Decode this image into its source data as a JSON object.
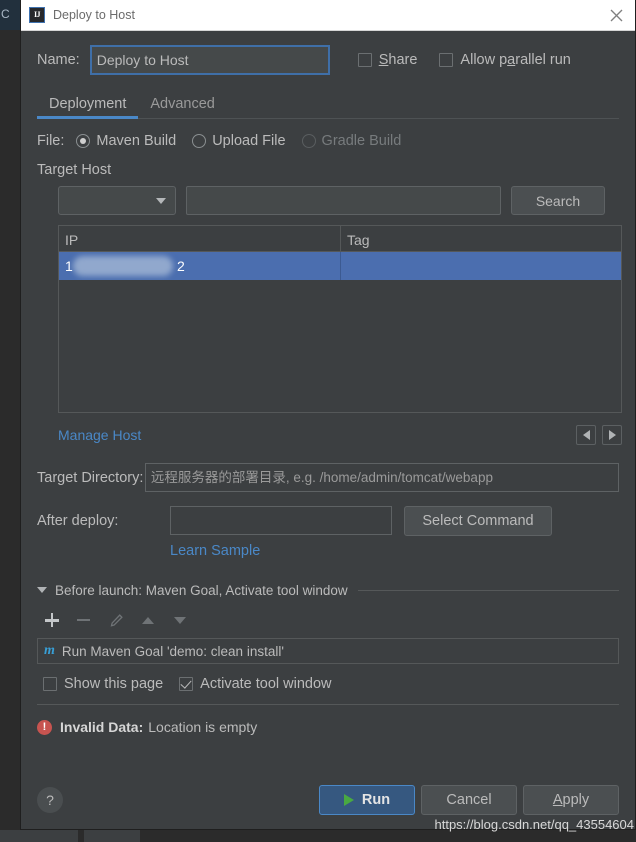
{
  "backdrop": {
    "left_char": "C",
    "watermark": "https://blog.csdn.net/qq_43554604"
  },
  "titlebar": {
    "app_icon": "intellij-idea-icon",
    "icon_text": "IJ",
    "title": "Deploy to Host",
    "close_icon": "close-icon"
  },
  "name_row": {
    "label": "Name:",
    "value": "Deploy to Host",
    "share": {
      "label": "Share",
      "mnemonic": "S",
      "checked": false
    },
    "parallel": {
      "label_pre": "Allow p",
      "mnemonic": "a",
      "label_post": "rallel run",
      "checked": false
    }
  },
  "tabs": [
    {
      "label": "Deployment",
      "active": true
    },
    {
      "label": "Advanced",
      "active": false
    }
  ],
  "file_row": {
    "label": "File:",
    "options": [
      {
        "label": "Maven Build",
        "selected": true,
        "disabled": false
      },
      {
        "label": "Upload File",
        "selected": false,
        "disabled": false
      },
      {
        "label": "Gradle Build",
        "selected": false,
        "disabled": true
      }
    ]
  },
  "target_host": {
    "section_label": "Target Host",
    "combo": {
      "value": "",
      "icon": "chevron-down-icon"
    },
    "search_input": {
      "value": "",
      "placeholder": ""
    },
    "search_button": "Search",
    "table": {
      "columns": [
        "IP",
        "Tag"
      ],
      "rows": [
        {
          "ip_prefix": "1",
          "ip_suffix": "2",
          "ip_redacted": true,
          "tag": "",
          "selected": true
        }
      ]
    },
    "manage_host_link": "Manage Host",
    "nav": {
      "prev_icon": "arrow-left-icon",
      "next_icon": "arrow-right-icon"
    }
  },
  "target_directory": {
    "label": "Target Directory:",
    "value": "",
    "placeholder": "远程服务器的部署目录, e.g. /home/admin/tomcat/webapp"
  },
  "after_deploy": {
    "label": "After deploy:",
    "value": "",
    "placeholder": "",
    "select_command_button": "Select Command",
    "learn_sample_link": "Learn Sample"
  },
  "before_launch": {
    "header": "Before launch: Maven Goal, Activate tool window",
    "collapse_icon": "triangle-down-icon",
    "toolbar": [
      {
        "name": "add-icon",
        "enabled": true
      },
      {
        "name": "remove-icon",
        "enabled": false
      },
      {
        "name": "edit-pencil-icon",
        "enabled": false
      },
      {
        "name": "move-up-icon",
        "enabled": false
      },
      {
        "name": "move-down-icon",
        "enabled": false
      }
    ],
    "items": [
      {
        "icon": "maven-icon",
        "icon_text": "m",
        "label": "Run Maven Goal 'demo: clean install'"
      }
    ],
    "show_this_page": {
      "label": "Show this page",
      "checked": false
    },
    "activate_tool_window": {
      "label": "Activate tool window",
      "checked": true
    }
  },
  "error": {
    "icon": "error-icon",
    "title": "Invalid Data:",
    "detail": "Location is empty"
  },
  "footer": {
    "help_icon": "question-mark-icon",
    "run_button": {
      "label": "Run",
      "icon": "play-icon"
    },
    "cancel_button": "Cancel",
    "apply_button": {
      "label_pre": "A",
      "mnemonic": "",
      "label": "Apply"
    }
  },
  "colors": {
    "dialog_bg": "#3c3f41",
    "titlebar_bg": "#ffffff",
    "accent_blue": "#4a88c7",
    "selection_blue": "#4b6eaf",
    "run_button_bg": "#365880",
    "error_red": "#c75450",
    "play_green": "#49a942",
    "text": "#bbbbbb"
  }
}
